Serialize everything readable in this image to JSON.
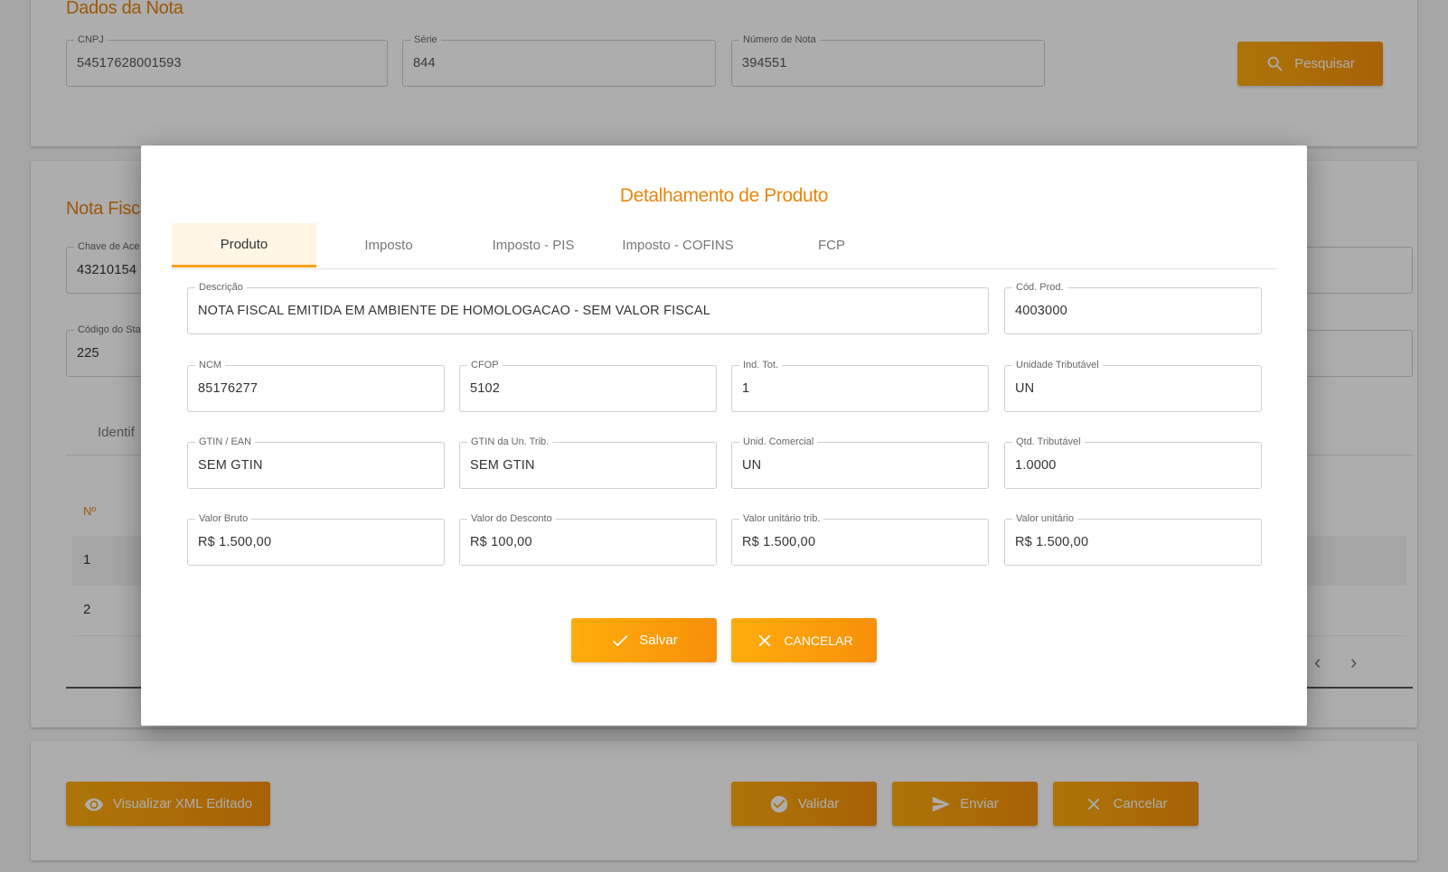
{
  "background": {
    "dados_nota": {
      "title": "Dados da Nota",
      "cnpj": {
        "label": "CNPJ",
        "value": "54517628001593"
      },
      "serie": {
        "label": "Série",
        "value": "844"
      },
      "numero": {
        "label": "Número de Nota",
        "value": "394551"
      },
      "search_label": "Pesquisar"
    },
    "nota_fiscal": {
      "title": "Nota Fiscal",
      "chave": {
        "label": "Chave de Ace",
        "value": "43210154"
      },
      "codigo": {
        "label": "Código do Sta",
        "value": "225"
      },
      "tab_partial": "Identif",
      "table_header_num": "Nº",
      "rows": [
        "1",
        "2"
      ]
    },
    "footer": {
      "view_xml_label": "Visualizar XML Editado",
      "validate_label": "Validar",
      "send_label": "Enviar",
      "cancel_label": "Cancelar"
    }
  },
  "modal": {
    "title": "Detalhamento de Produto",
    "tabs": [
      "Produto",
      "Imposto",
      "Imposto - PIS",
      "Imposto - COFINS",
      "FCP"
    ],
    "active_tab": "Produto",
    "fields": {
      "descricao": {
        "label": "Descrição",
        "value": "NOTA FISCAL EMITIDA EM AMBIENTE DE HOMOLOGACAO - SEM VALOR FISCAL"
      },
      "cod_prod": {
        "label": "Cód. Prod.",
        "value": "4003000"
      },
      "ncm": {
        "label": "NCM",
        "value": "85176277"
      },
      "cfop": {
        "label": "CFOP",
        "value": "5102"
      },
      "ind_tot": {
        "label": "Ind. Tot.",
        "value": "1"
      },
      "unidade_tributavel": {
        "label": "Unidade Tributável",
        "value": "UN"
      },
      "gtin_ean": {
        "label": "GTIN / EAN",
        "value": "SEM GTIN"
      },
      "gtin_un_trib": {
        "label": "GTIN da Un. Trib.",
        "value": "SEM GTIN"
      },
      "unid_comercial": {
        "label": "Unid. Comercial",
        "value": "UN"
      },
      "qtd_tributavel": {
        "label": "Qtd. Tributável",
        "value": "1.0000"
      },
      "valor_bruto": {
        "label": "Valor Bruto",
        "value": "R$ 1.500,00"
      },
      "valor_desconto": {
        "label": "Valor do Desconto",
        "value": "R$ 100,00"
      },
      "valor_unitario_trib": {
        "label": "Valor unitário trib.",
        "value": "R$ 1.500,00"
      },
      "valor_unitario": {
        "label": "Valor unitário",
        "value": "R$ 1.500,00"
      }
    },
    "save_label": "Salvar",
    "cancel_label": "CANCELAR"
  },
  "colors": {
    "accent": "#f79009",
    "title": "#e8820c",
    "tab_active_bg": "#fff6e5"
  }
}
